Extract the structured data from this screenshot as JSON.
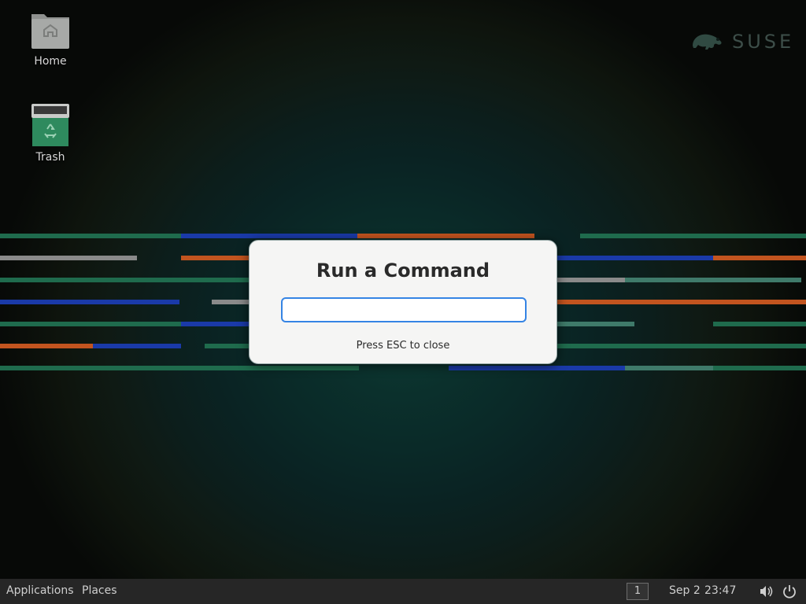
{
  "desktop": {
    "icons": [
      {
        "label": "Home"
      },
      {
        "label": "Trash"
      }
    ],
    "brand": {
      "text": "SUSE",
      "icon": "chameleon-logo"
    }
  },
  "dialog": {
    "title": "Run a Command",
    "input_value": "",
    "hint": "Press ESC to close"
  },
  "panel": {
    "applications_label": "Applications",
    "places_label": "Places",
    "workspace": "1",
    "date": "Sep 2",
    "time": "23:47",
    "icons": [
      "volume-icon",
      "power-icon"
    ]
  },
  "colors": {
    "accent": "#3584e4",
    "stripe_green": "#1f6b4d",
    "stripe_blue": "#1a3aa8",
    "stripe_orange": "#c2541f",
    "stripe_gray": "#8a8a8a",
    "stripe_teal": "#3f7a6a",
    "panel_bg": "#262626"
  }
}
